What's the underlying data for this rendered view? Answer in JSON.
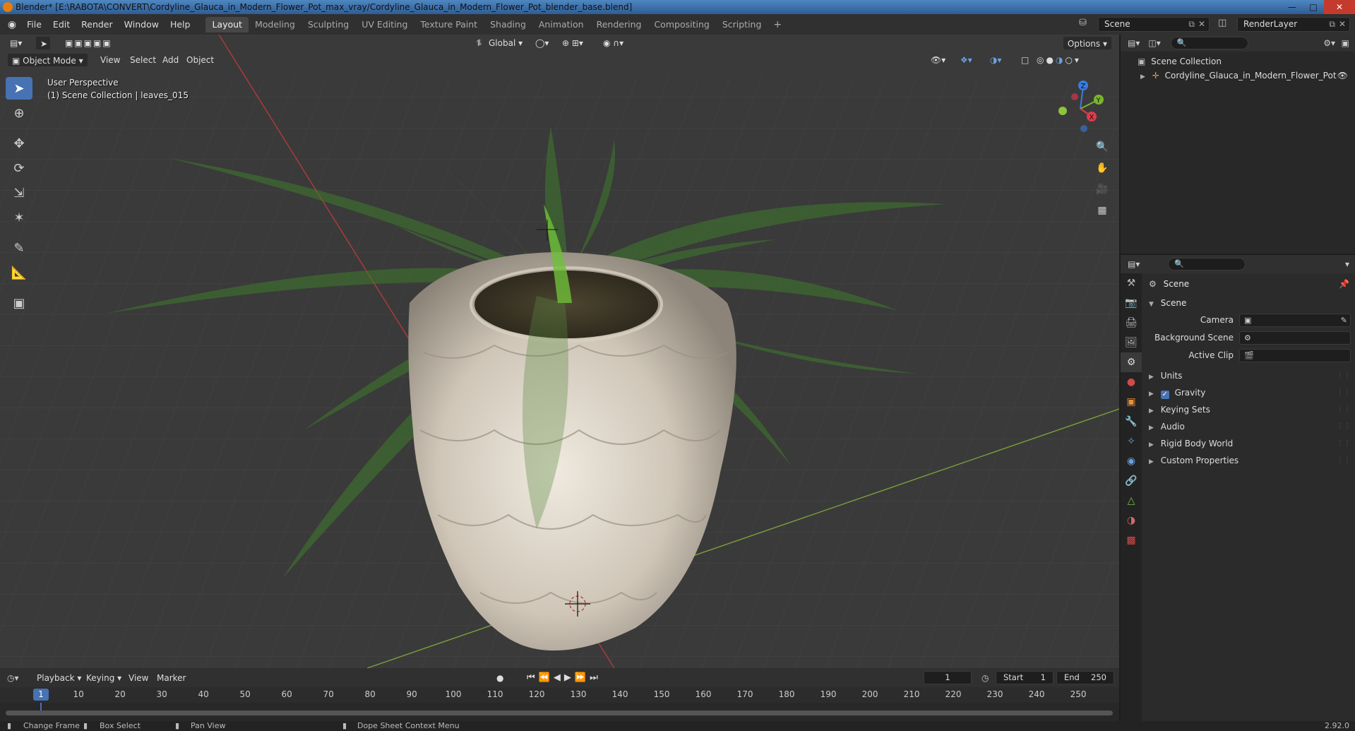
{
  "window": {
    "title": "Blender* [E:\\RABOTA\\CONVERT\\Cordyline_Glauca_in_Modern_Flower_Pot_max_vray/Cordyline_Glauca_in_Modern_Flower_Pot_blender_base.blend]"
  },
  "menu": {
    "items": [
      "File",
      "Edit",
      "Render",
      "Window",
      "Help"
    ]
  },
  "workspaces": {
    "tabs": [
      "Layout",
      "Modeling",
      "Sculpting",
      "UV Editing",
      "Texture Paint",
      "Shading",
      "Animation",
      "Rendering",
      "Compositing",
      "Scripting"
    ],
    "active": "Layout"
  },
  "scene_selector": {
    "value": "Scene"
  },
  "view_layer": {
    "value": "RenderLayer"
  },
  "viewport": {
    "orientation": "Global",
    "options_label": "Options",
    "mode": "Object Mode",
    "menus": [
      "View",
      "Select",
      "Add",
      "Object"
    ],
    "info_line1": "User Perspective",
    "info_line2": "(1) Scene Collection | leaves_015",
    "gizmo_axes": [
      "Z",
      "Y",
      "X"
    ]
  },
  "outliner": {
    "root": "Scene Collection",
    "items": [
      "Cordyline_Glauca_in_Modern_Flower_Pot"
    ]
  },
  "properties": {
    "context": "Scene",
    "panel": "Scene",
    "fields": [
      {
        "label": "Camera",
        "value": ""
      },
      {
        "label": "Background Scene",
        "value": ""
      },
      {
        "label": "Active Clip",
        "value": ""
      }
    ],
    "subpanels": [
      "Units",
      "Gravity",
      "Keying Sets",
      "Audio",
      "Rigid Body World",
      "Custom Properties"
    ],
    "gravity_checked": true
  },
  "timeline": {
    "menus": [
      "Playback",
      "Keying",
      "View",
      "Marker"
    ],
    "current_frame": "1",
    "start_label": "Start",
    "start": "1",
    "end_label": "End",
    "end": "250",
    "ruler": [
      "1",
      "10",
      "20",
      "30",
      "40",
      "50",
      "60",
      "70",
      "80",
      "90",
      "100",
      "110",
      "120",
      "130",
      "140",
      "150",
      "160",
      "170",
      "180",
      "190",
      "200",
      "210",
      "220",
      "230",
      "240",
      "250"
    ]
  },
  "statusbar": {
    "items": [
      "Change Frame",
      "Box Select",
      "Pan View",
      "Dope Sheet Context Menu"
    ],
    "version": "2.92.0"
  }
}
